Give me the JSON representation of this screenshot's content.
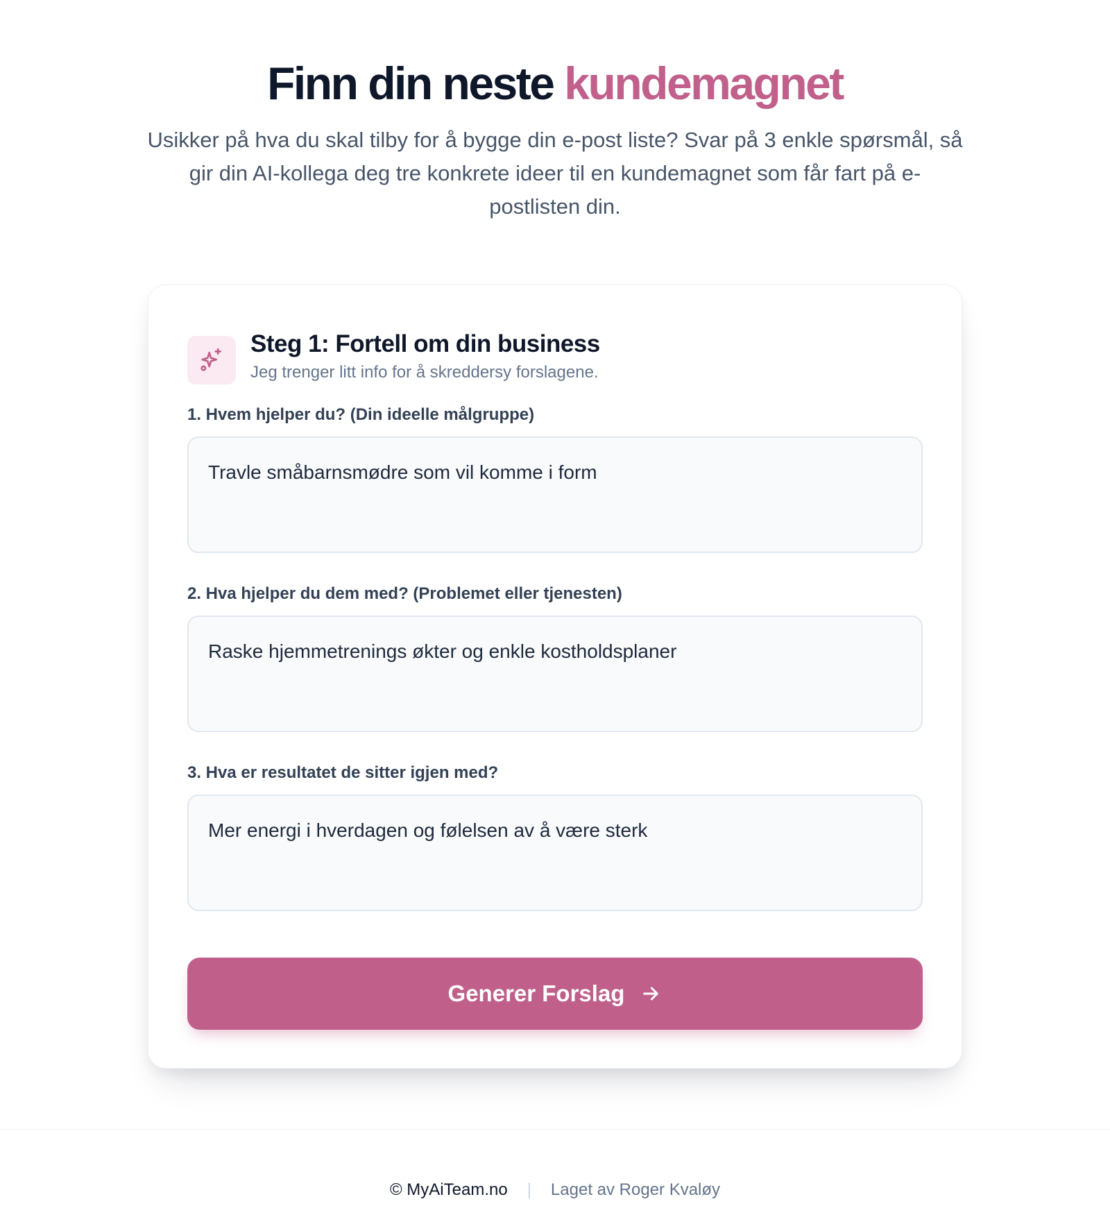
{
  "hero": {
    "title_main": "Finn din neste",
    "title_accent": "kundemagnet",
    "subtitle": "Usikker på hva du skal tilby for å bygge din e-post liste? Svar på 3 enkle spørsmål, så gir din AI-kollega deg tre konkrete ideer til en kundemagnet som får fart på e-postlisten din."
  },
  "step": {
    "icon": "sparkles-icon",
    "title": "Steg 1: Fortell om din business",
    "subtitle": "Jeg trenger litt info for å skreddersy forslagene."
  },
  "fields": [
    {
      "label": "1. Hvem hjelper du? (Din ideelle målgruppe)",
      "value": "Travle småbarnsmødre som vil komme i form"
    },
    {
      "label": "2. Hva hjelper du dem med? (Problemet eller tjenesten)",
      "value": "Raske hjemmetrenings økter og enkle kostholdsplaner"
    },
    {
      "label": "3. Hva er resultatet de sitter igjen med?",
      "value": "Mer energi i hverdagen og følelsen av å være sterk"
    }
  ],
  "submit": {
    "label": "Generer Forslag",
    "icon": "arrow-right-icon"
  },
  "footer": {
    "copyright": "© MyAiTeam.no",
    "separator": "|",
    "credit": "Laget av Roger Kvaløy"
  },
  "colors": {
    "accent": "#c0608b",
    "button": "#bf5f8a",
    "heading": "#0f172a",
    "muted": "#64748b"
  }
}
